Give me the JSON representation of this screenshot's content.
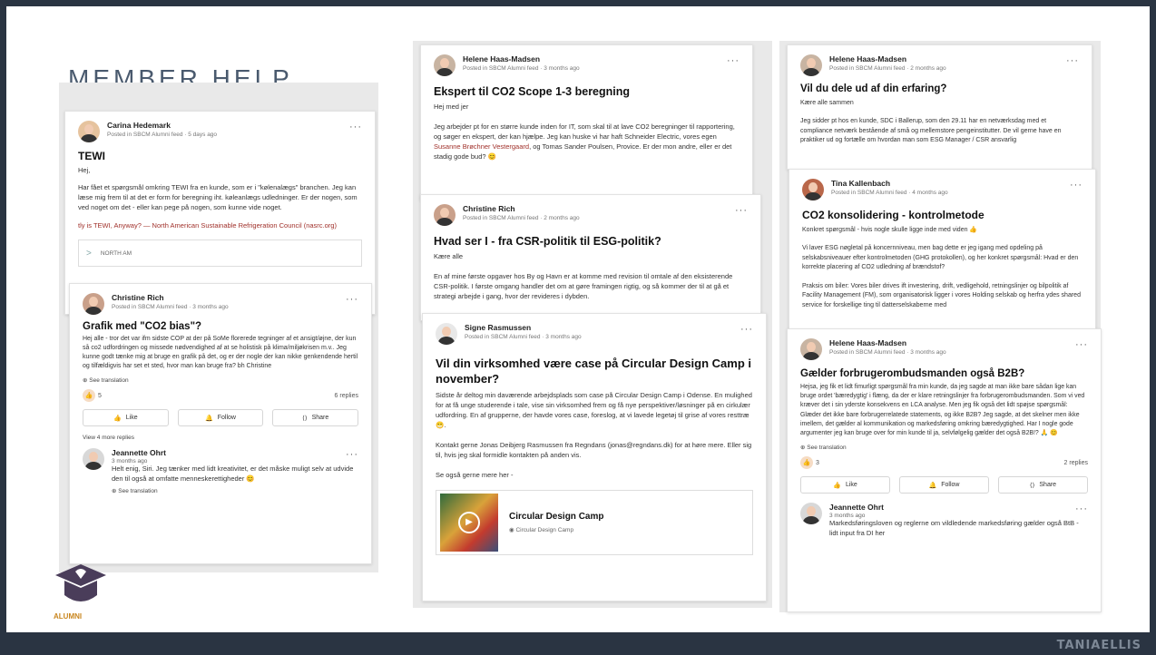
{
  "slide": {
    "title": "MEMBER HELP",
    "brand": "TANIAELLIS",
    "logo_text": "ALUMNI"
  },
  "posts": {
    "tewi": {
      "author": "Carina Hedemark",
      "meta": "Posted in SBCM Alumni feed · 5 days ago",
      "title": "TEWI",
      "greeting": "Hej,",
      "body": "Har fået et spørgsmål omkring TEWI fra en kunde, som er i \"kølenalægs\" branchen. Jeg kan læse mig frem til at det er form for beregning iht. køleanlægs udledninger. Er der nogen, som ved noget om det - eller kan pege på nogen, som kunne vide noget.",
      "link": "tly is TEWI, Anyway? — North American Sustainable Refrigeration Council (nasrc.org)",
      "preview": "NORTH AM"
    },
    "co2bias": {
      "author": "Christine Rich",
      "meta": "Posted in SBCM Alumni feed · 3 months ago",
      "title": "Grafik med \"CO2 bias\"?",
      "body": "Hej alle - tror det var ifm sidste COP at der på SoMe florerede tegninger af et ansigt/øjne, der kun så co2 udfordringen og missede nødvendighed af at se holistisk på klima/miljøkrisen m.v.. Jeg kunne godt tænke mig at bruge en grafik på det, og er der nogle der kan nikke genkendende hertil og tilfældigvis har set et sted, hvor man kan bruge fra? bh Christine",
      "translation": "See translation",
      "reactions": "5",
      "replies": "6 replies",
      "like": "Like",
      "follow": "Follow",
      "share": "Share",
      "more": "View 4 more replies",
      "reply": {
        "author": "Jeannette Ohrt",
        "time": "3 months ago",
        "text": "Helt enig, Siri. Jeg tænker med lidt kreativitet, er det måske muligt selv at udvide den til også at omfatte menneskerettigheder 😊",
        "translation": "See translation"
      }
    },
    "scope": {
      "author": "Helene Haas-Madsen",
      "meta": "Posted in SBCM Alumni feed · 3 months ago",
      "title": "Ekspert til CO2 Scope 1-3 beregning",
      "greeting": "Hej med jer",
      "body_a": "Jeg arbejder pt for en større kunde inden for IT, som skal til at lave CO2 beregninger til rapportering, og søger en ekspert, der kan hjælpe. Jeg kan huske vi har haft Schneider Electric, vores egen ",
      "body_link": "Susanne Brøchner Vestergaard",
      "body_b": ", og Tomas Sander Poulsen, Provice. Er der mon andre, eller er det stadig gode bud? 😊"
    },
    "csr": {
      "author": "Christine Rich",
      "meta": "Posted in SBCM Alumni feed · 2 months ago",
      "title": "Hvad ser I - fra CSR-politik til ESG-politik?",
      "greeting": "Kære alle",
      "body": "En af mine første opgaver hos By og Havn er at komme med revision til omtale af den eksisterende CSR-politik. I første omgang handler det om at gøre framingen rigtig, og så kommer der til at gå et strategi arbejde i gang, hvor der revideres i dybden."
    },
    "circular": {
      "author": "Signe Rasmussen",
      "meta": "Posted in SBCM Alumni feed · 3 months ago",
      "title": "Vil din virksomhed være case på Circular Design Camp i november?",
      "body1": "Sidste år deltog min daværende arbejdsplads som case på Circular Design Camp i Odense. En mulighed for at få unge studerende i tale, vise sin virksomhed frem og få nye perspektiver/løsninger på en cirkulær udfordring. En af grupperne, der havde vores case, foreslog, at vi lavede legetøj til grise af vores resttræ 😁.",
      "body2": "Kontakt gerne Jonas Deibjerg Rasmussen fra Regndans (jonas@regndans.dk) for at høre mere. Eller sig til, hvis jeg skal formidle kontakten på anden vis.",
      "body3": "Se også gerne mere her -",
      "card_title": "Circular Design Camp",
      "card_sub": "Circular Design Camp"
    },
    "erfaring": {
      "author": "Helene Haas-Madsen",
      "meta": "Posted in SBCM Alumni feed · 2 months ago",
      "title": "Vil du dele ud af din erfaring?",
      "greeting": "Kære alle sammen",
      "body": "Jeg sidder pt hos en kunde, SDC i Ballerup, som den 29.11 har en netværksdag med et compliance netværk bestående af små og mellemstore pengeinstitutter. De vil gerne have en praktiker ud og fortælle om hvordan man som ESG Manager / CSR ansvarlig"
    },
    "konsolidering": {
      "author": "Tina Kallenbach",
      "meta": "Posted in SBCM Alumni feed · 4 months ago",
      "title": "CO2 konsolidering - kontrolmetode",
      "greeting": "Konkret spørgsmål - hvis nogle skulle ligge inde med viden 👍",
      "body1": "Vi laver ESG nøgletal på koncernniveau, men bag dette er jeg igang med opdeling på selskabsniveauer efter kontrolmetoden (GHG protokollen), og her konkret spørgsmål: Hvad er den korrekte placering af CO2 udledning af brændstof?",
      "body2": "Praksis om biler: Vores biler drives ift investering, drift, vedligehold, retningslinjer og bilpolitik af Facility Management (FM), som organisatorisk ligger i vores Holding selskab og herfra ydes shared service for forskellige ting til datterselskaberne med"
    },
    "b2b": {
      "author": "Helene Haas-Madsen",
      "meta": "Posted in SBCM Alumni feed · 3 months ago",
      "title": "Gælder forbrugerombudsmanden også B2B?",
      "body": "Hejsa, jeg fik et lidt fimurligt spørgsmål fra min kunde, da jeg sagde at man ikke bare sådan lige kan bruge ordet 'bæredygtig' i flæng, da der er klare retningslinjer fra forbrugerombudsmanden. Som vi ved kræver det i sin yderste konsekvens en LCA analyse. Men jeg fik også det lidt spøjse spørgsmål: Glæder det ikke bare forbrugerrelatede statements, og ikke B2B? Jeg sagde, at det skelner men ikke imellem, det gælder al kommunikation og markedsføring omkring bæredygtighed. Har I nogle gode argumenter jeg kan bruge over for min kunde til ja, selvfølgelig gælder det også B2B!? 🙏 😊",
      "translation": "See translation",
      "reactions": "3",
      "replies": "2 replies",
      "like": "Like",
      "follow": "Follow",
      "share": "Share",
      "reply": {
        "author": "Jeannette Ohrt",
        "time": "3 months ago",
        "text": "Markedsføringsloven og reglerne om vildledende markedsføring gælder også BtB - lidt input fra DI her"
      }
    }
  },
  "colors": {
    "accent_link": "#a0302a",
    "background": "#2a3442",
    "logo": "#4a3d5a"
  }
}
